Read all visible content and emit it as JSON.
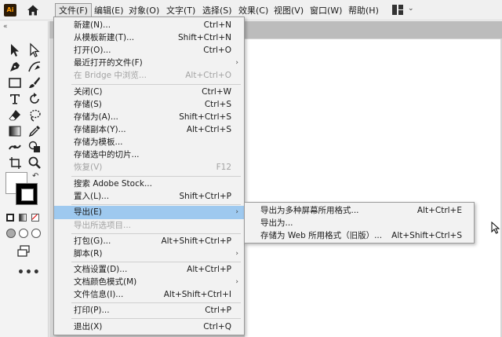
{
  "app": {
    "logo_text": "Ai"
  },
  "menubar": {
    "items": [
      {
        "label": "文件(F)"
      },
      {
        "label": "编辑(E)"
      },
      {
        "label": "对象(O)"
      },
      {
        "label": "文字(T)"
      },
      {
        "label": "选择(S)"
      },
      {
        "label": "效果(C)"
      },
      {
        "label": "视图(V)"
      },
      {
        "label": "窗口(W)"
      },
      {
        "label": "帮助(H)"
      }
    ],
    "active_item": "文件(F)"
  },
  "toolbar": {
    "collapse_glyph": "«",
    "more_glyph": "•••",
    "swap_glyph": "↶",
    "tools": [
      {
        "icon": "selection-tool-icon"
      },
      {
        "icon": "direct-selection-tool-icon"
      },
      {
        "icon": "pen-tool-icon"
      },
      {
        "icon": "curvature-tool-icon"
      },
      {
        "icon": "rectangle-tool-icon"
      },
      {
        "icon": "paintbrush-tool-icon"
      },
      {
        "icon": "type-tool-icon"
      },
      {
        "icon": "rotate-tool-icon"
      },
      {
        "icon": "eraser-tool-icon"
      },
      {
        "icon": "lasso-tool-icon"
      },
      {
        "icon": "gradient-tool-icon"
      },
      {
        "icon": "eyedropper-tool-icon"
      },
      {
        "icon": "width-tool-icon"
      },
      {
        "icon": "shape-builder-tool-icon"
      },
      {
        "icon": "artboard-tool-icon"
      },
      {
        "icon": "zoom-tool-icon"
      }
    ]
  },
  "file_menu": {
    "items": [
      {
        "label": "新建(N)...",
        "shortcut": "Ctrl+N",
        "disabled": false
      },
      {
        "label": "从模板新建(T)...",
        "shortcut": "Shift+Ctrl+N",
        "disabled": false
      },
      {
        "label": "打开(O)...",
        "shortcut": "Ctrl+O",
        "disabled": false
      },
      {
        "label": "最近打开的文件(F)",
        "shortcut": "",
        "submenu": true,
        "disabled": false
      },
      {
        "label": "在 Bridge 中浏览...",
        "shortcut": "Alt+Ctrl+O",
        "disabled": true
      },
      {
        "label": "关闭(C)",
        "shortcut": "Ctrl+W",
        "disabled": false
      },
      {
        "label": "存储(S)",
        "shortcut": "Ctrl+S",
        "disabled": false
      },
      {
        "label": "存储为(A)...",
        "shortcut": "Shift+Ctrl+S",
        "disabled": false
      },
      {
        "label": "存储副本(Y)...",
        "shortcut": "Alt+Ctrl+S",
        "disabled": false
      },
      {
        "label": "存储为模板...",
        "shortcut": "",
        "disabled": false
      },
      {
        "label": "存储选中的切片...",
        "shortcut": "",
        "disabled": false
      },
      {
        "label": "恢复(V)",
        "shortcut": "F12",
        "disabled": true
      },
      {
        "label": "搜索 Adobe Stock...",
        "shortcut": "",
        "disabled": false
      },
      {
        "label": "置入(L)...",
        "shortcut": "Shift+Ctrl+P",
        "disabled": false
      },
      {
        "label": "导出(E)",
        "shortcut": "",
        "submenu": true,
        "highlight": true,
        "disabled": false
      },
      {
        "label": "导出所选项目...",
        "shortcut": "",
        "disabled": true
      },
      {
        "label": "打包(G)...",
        "shortcut": "Alt+Shift+Ctrl+P",
        "disabled": false
      },
      {
        "label": "脚本(R)",
        "shortcut": "",
        "submenu": true,
        "disabled": false
      },
      {
        "label": "文档设置(D)...",
        "shortcut": "Alt+Ctrl+P",
        "disabled": false
      },
      {
        "label": "文档颜色模式(M)",
        "shortcut": "",
        "submenu": true,
        "disabled": false
      },
      {
        "label": "文件信息(I)...",
        "shortcut": "Alt+Shift+Ctrl+I",
        "disabled": false
      },
      {
        "label": "打印(P)...",
        "shortcut": "Ctrl+P",
        "disabled": false
      },
      {
        "label": "退出(X)",
        "shortcut": "Ctrl+Q",
        "disabled": false
      }
    ],
    "submenu_arrow": "›"
  },
  "export_submenu": {
    "items": [
      {
        "label": "导出为多种屏幕所用格式...",
        "shortcut": "Alt+Ctrl+E"
      },
      {
        "label": "导出为...",
        "shortcut": ""
      },
      {
        "label": "存储为 Web 所用格式（旧版）...",
        "shortcut": "Alt+Shift+Ctrl+S"
      }
    ]
  },
  "colors": {
    "menu_highlight": "#9ec9ef",
    "disabled_text": "#a3a3a3",
    "app_icon_bg": "#2b1a06",
    "app_icon_fg": "#ff9a00"
  }
}
